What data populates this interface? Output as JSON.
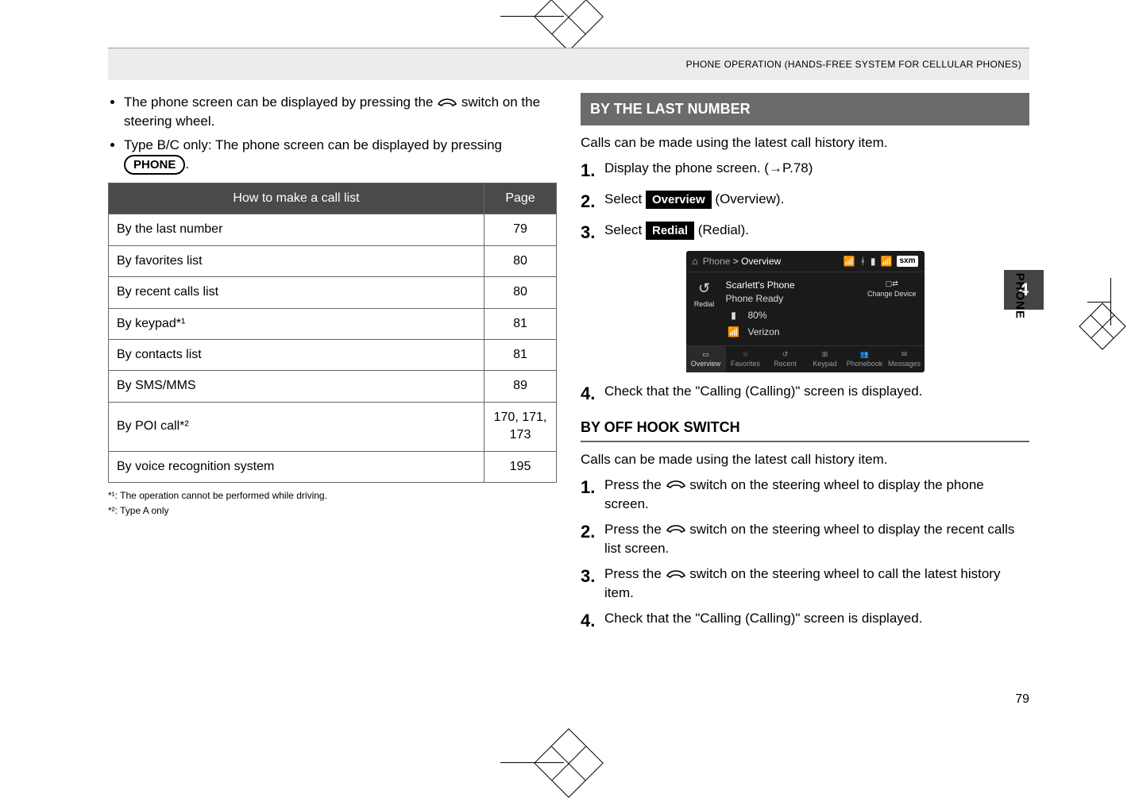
{
  "header_caption": "PHONE OPERATION (HANDS-FREE SYSTEM FOR CELLULAR PHONES)",
  "left": {
    "bullet1_pre": "The phone screen can be displayed by pressing the ",
    "bullet1_post": " switch on the steering wheel.",
    "bullet2_pre": "Type B/C only: The phone screen can be displayed by pressing ",
    "bullet2_btn": "PHONE",
    "bullet2_post": ".",
    "table": {
      "head_left": "How to make a call list",
      "head_right": "Page",
      "rows": [
        {
          "label": "By the last number",
          "page": "79"
        },
        {
          "label": "By favorites list",
          "page": "80"
        },
        {
          "label": "By recent calls list",
          "page": "80"
        },
        {
          "label": "By keypad*¹",
          "page": "81"
        },
        {
          "label": "By contacts list",
          "page": "81"
        },
        {
          "label": "By SMS/MMS",
          "page": "89"
        },
        {
          "label": "By POI call*²",
          "page": "170, 171, 173"
        },
        {
          "label": "By voice recognition system",
          "page": "195"
        }
      ]
    },
    "footnote1": "*¹:  The operation cannot be performed while driving.",
    "footnote2": "*²:  Type A only"
  },
  "right": {
    "section_title": "BY THE LAST NUMBER",
    "section_intro": "Calls can be made using the latest call history item.",
    "steps_a": [
      {
        "n": "1.",
        "text": "Display the phone screen. (→P.78)"
      },
      {
        "n": "2.",
        "pre": "Select ",
        "pill": "Overview",
        "post": " (Overview)."
      },
      {
        "n": "3.",
        "pre": "Select ",
        "pill": "Redial",
        "post": " (Redial)."
      }
    ],
    "screenshot": {
      "breadcrumb_root": "Phone",
      "breadcrumb_child": "Overview",
      "sxm": "sxm",
      "redial_label": "Redial",
      "device_name": "Scarlett's Phone",
      "device_status": "Phone Ready",
      "change_device": "Change Device",
      "battery": "80%",
      "carrier": "Verizon",
      "tabs": [
        "Overview",
        "Favorites",
        "Recent",
        "Keypad",
        "Phonebook",
        "Messages"
      ]
    },
    "step_a4": {
      "n": "4.",
      "text": "Check that the \"Calling (Calling)\" screen is displayed."
    },
    "subheading": "BY OFF HOOK SWITCH",
    "sub_intro": "Calls can be made using the latest call history item.",
    "steps_b": [
      {
        "n": "1.",
        "pre": "Press the ",
        "post": " switch on the steering wheel to display the phone screen."
      },
      {
        "n": "2.",
        "pre": "Press the ",
        "post": " switch on the steering wheel to display the recent calls list screen."
      },
      {
        "n": "3.",
        "pre": "Press the ",
        "post": " switch on the steering wheel to call the latest history item."
      },
      {
        "n": "4.",
        "text": "Check that the \"Calling (Calling)\" screen is displayed."
      }
    ]
  },
  "side": {
    "chapter": "4",
    "label": "PHONE"
  },
  "page_number": "79"
}
